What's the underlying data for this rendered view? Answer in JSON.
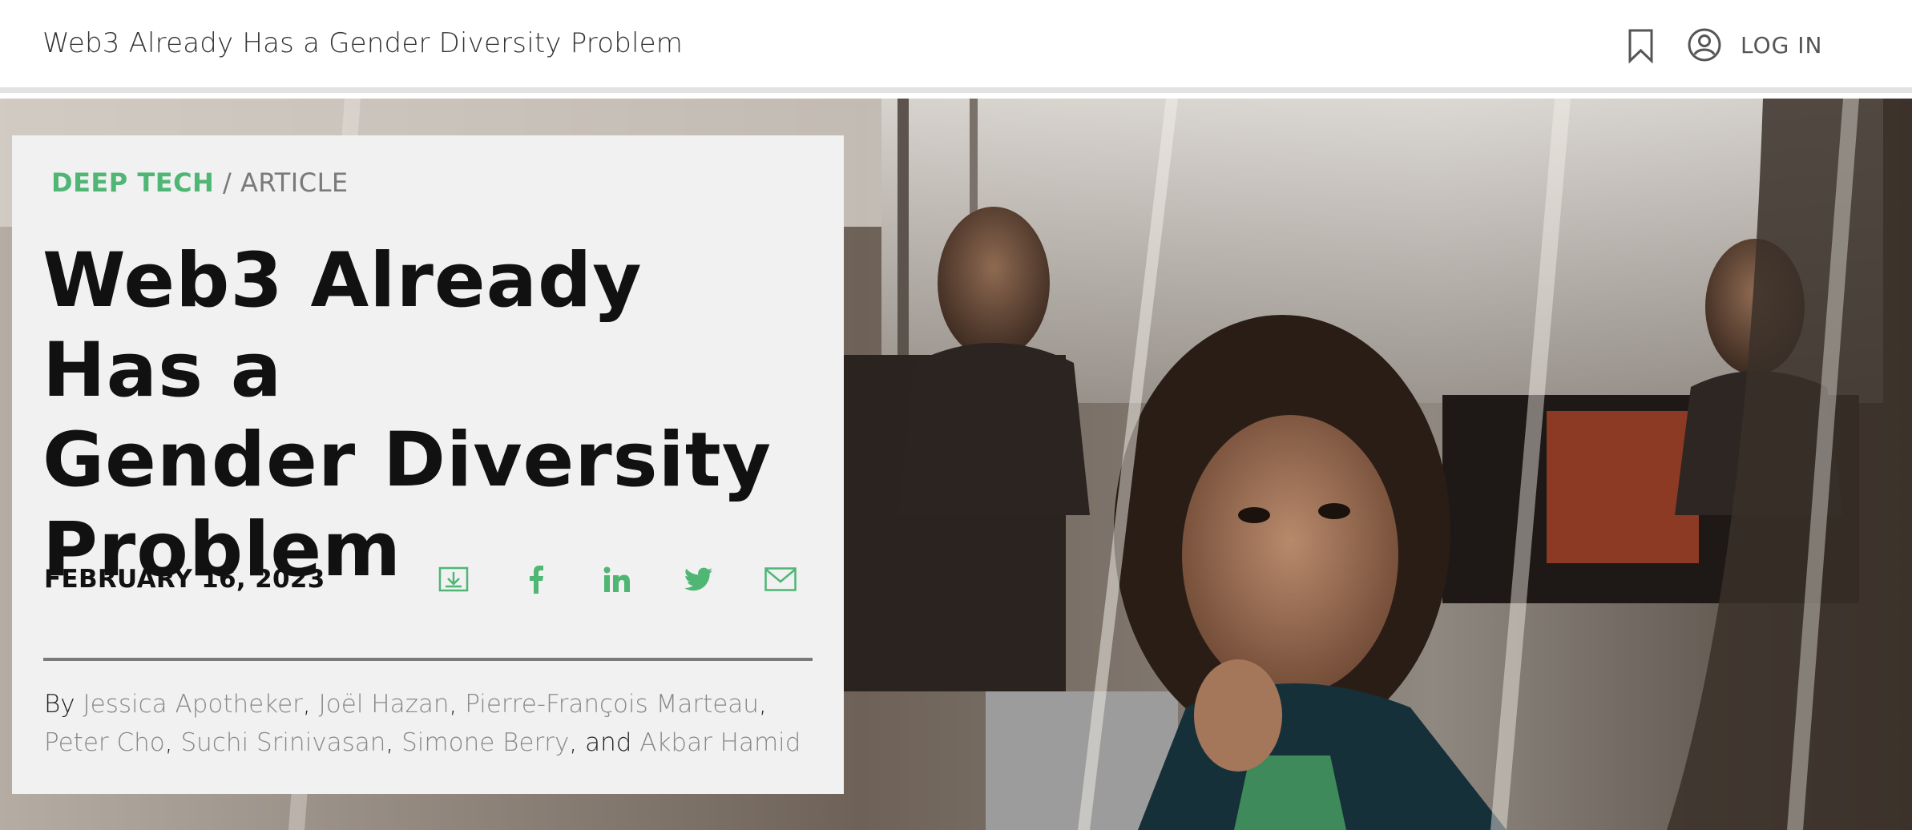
{
  "header": {
    "title": "Web3 Already Has a Gender Diversity Problem",
    "bookmark_icon": "bookmark-icon",
    "user_icon": "user-circle-icon",
    "login_label": "LOG IN"
  },
  "article": {
    "topic": "DEEP TECH",
    "separator": " / ",
    "content_type": "ARTICLE",
    "headline_lines": [
      "Web3 Already Has a",
      "Gender Diversity",
      "Problem"
    ],
    "date": "FEBRUARY 16, 2023",
    "share_icons": [
      "download-icon",
      "facebook-icon",
      "linkedin-icon",
      "twitter-icon",
      "email-icon"
    ],
    "byline": {
      "prefix": "By ",
      "authors": [
        "Jessica Apotheker",
        "Joël Hazan",
        "Pierre-François Marteau",
        "Peter Cho",
        "Suchi Srinivasan",
        "Simone Berry",
        "Akbar Hamid"
      ],
      "separator": ", ",
      "last_separator": ", and "
    }
  },
  "colors": {
    "accent_green": "#4fb674",
    "card_background": "#f1f1f1",
    "muted_gray": "#7a7a7a"
  }
}
